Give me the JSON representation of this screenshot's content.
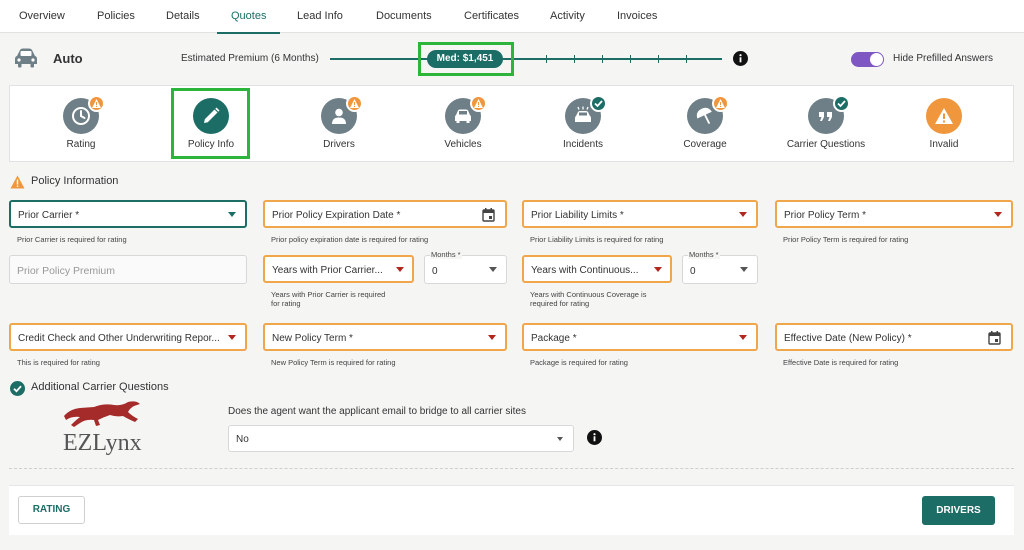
{
  "nav": {
    "tabs": [
      {
        "label": "Overview"
      },
      {
        "label": "Policies"
      },
      {
        "label": "Details"
      },
      {
        "label": "Quotes",
        "active": true
      },
      {
        "label": "Lead Info"
      },
      {
        "label": "Documents"
      },
      {
        "label": "Certificates"
      },
      {
        "label": "Activity"
      },
      {
        "label": "Invoices"
      }
    ]
  },
  "header": {
    "line_of_business": "Auto",
    "estimate_label": "Estimated Premium (6 Months)",
    "estimate_value": "Med: $1,451",
    "toggle_label": "Hide Prefilled Answers",
    "toggle_on": true
  },
  "steps": [
    {
      "label": "Rating",
      "icon": "clock-icon",
      "badge": "warning"
    },
    {
      "label": "Policy Info",
      "icon": "pencil-icon",
      "badge": "none",
      "active": true
    },
    {
      "label": "Drivers",
      "icon": "person-icon",
      "badge": "warning"
    },
    {
      "label": "Vehicles",
      "icon": "car-icon",
      "badge": "warning"
    },
    {
      "label": "Incidents",
      "icon": "incident-car-icon",
      "badge": "check"
    },
    {
      "label": "Coverage",
      "icon": "umbrella-icon",
      "badge": "warning"
    },
    {
      "label": "Carrier Questions",
      "icon": "quote-icon",
      "badge": "check"
    },
    {
      "label": "Invalid",
      "icon": "warning-icon",
      "badge": "none"
    }
  ],
  "policy_section": {
    "title": "Policy Information",
    "fields": {
      "prior_carrier": {
        "label": "Prior Carrier *",
        "helper": "Prior Carrier is required for rating"
      },
      "prior_expiration": {
        "label": "Prior Policy Expiration Date *",
        "helper": "Prior policy expiration date is required for rating"
      },
      "prior_liability": {
        "label": "Prior Liability Limits *",
        "helper": "Prior Liability Limits is required for rating"
      },
      "prior_term": {
        "label": "Prior Policy Term *",
        "helper": "Prior Policy Term is required for rating"
      },
      "prior_premium": {
        "placeholder": "Prior Policy Premium"
      },
      "years_prior_carrier": {
        "label": "Years with Prior Carrier...",
        "helper_line1": "Years with Prior Carrier is required",
        "helper_line2": "for rating"
      },
      "months_prior": {
        "label": "Months *",
        "value": "0"
      },
      "years_continuous": {
        "label": "Years with Continuous...",
        "helper_line1": "Years with Continuous Coverage is",
        "helper_line2": "required for rating"
      },
      "months_continuous": {
        "label": "Months *",
        "value": "0"
      },
      "credit_check": {
        "label": "Credit Check and Other Underwriting Repor...",
        "helper": "This is required for rating"
      },
      "new_term": {
        "label": "New Policy Term *",
        "helper": "New Policy Term is required for rating"
      },
      "package": {
        "label": "Package *",
        "helper": "Package is required for rating"
      },
      "effective_date": {
        "label": "Effective Date (New Policy) *",
        "helper": "Effective Date is required for rating"
      }
    }
  },
  "carrier_section": {
    "title": "Additional Carrier Questions",
    "logo_text": "EZLynx",
    "question": "Does the agent want the applicant email to bridge to all carrier sites",
    "answer": "No"
  },
  "footer": {
    "back_label": "RATING",
    "next_label": "DRIVERS"
  },
  "colors": {
    "primary": "#1d6d67",
    "warning": "#f0963c",
    "error": "#b3261e",
    "highlight": "#2db43a",
    "toggle": "#7e57c2"
  }
}
